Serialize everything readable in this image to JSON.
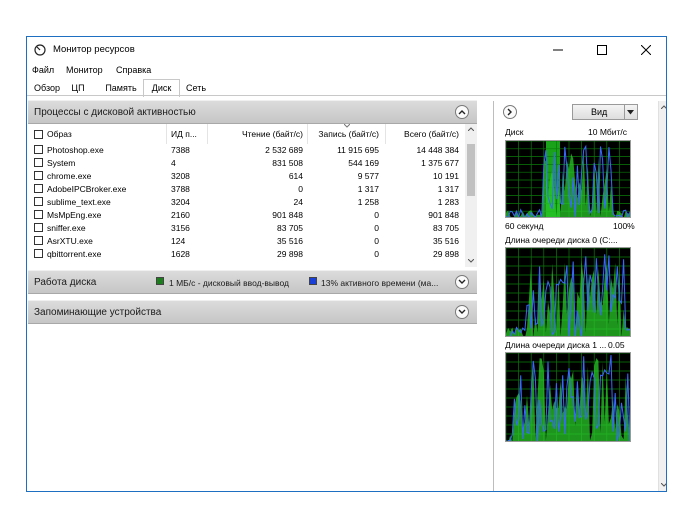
{
  "window": {
    "title": "Монитор ресурсов",
    "minimize_icon": "minimize-icon",
    "maximize_icon": "maximize-icon",
    "close_icon": "close-icon"
  },
  "menu": [
    "Файл",
    "Монитор",
    "Справка"
  ],
  "tabs": [
    {
      "label": "Обзор",
      "active": false
    },
    {
      "label": "ЦП",
      "active": false
    },
    {
      "label": "Память",
      "active": false
    },
    {
      "label": "Диск",
      "active": true
    },
    {
      "label": "Сеть",
      "active": false
    }
  ],
  "processes": {
    "title": "Процессы с дисковой активностью",
    "columns": [
      "Образ",
      "ИД п...",
      "Чтение (байт/с)",
      "Запись (байт/с)",
      "Всего (байт/с)"
    ],
    "rows": [
      {
        "image": "Photoshop.exe",
        "pid": "7388",
        "read": "2 532 689",
        "write": "11 915 695",
        "total": "14 448 384"
      },
      {
        "image": "System",
        "pid": "4",
        "read": "831 508",
        "write": "544 169",
        "total": "1 375 677"
      },
      {
        "image": "chrome.exe",
        "pid": "3208",
        "read": "614",
        "write": "9 577",
        "total": "10 191"
      },
      {
        "image": "AdobeIPCBroker.exe",
        "pid": "3788",
        "read": "0",
        "write": "1 317",
        "total": "1 317"
      },
      {
        "image": "sublime_text.exe",
        "pid": "3204",
        "read": "24",
        "write": "1 258",
        "total": "1 283"
      },
      {
        "image": "MsMpEng.exe",
        "pid": "2160",
        "read": "901 848",
        "write": "0",
        "total": "901 848"
      },
      {
        "image": "sniffer.exe",
        "pid": "3156",
        "read": "83 705",
        "write": "0",
        "total": "83 705"
      },
      {
        "image": "AsrXTU.exe",
        "pid": "124",
        "read": "35 516",
        "write": "0",
        "total": "35 516"
      },
      {
        "image": "qbittorrent.exe",
        "pid": "1628",
        "read": "29 898",
        "write": "0",
        "total": "29 898"
      }
    ]
  },
  "disk_activity": {
    "title": "Работа диска",
    "legend_io": "1 МБ/с - дисковый ввод-вывод",
    "legend_io_color": "#1a7f1a",
    "legend_time": "13% активного времени (ма...",
    "legend_time_color": "#1a3fd6"
  },
  "storage": {
    "title": "Запоминающие устройства"
  },
  "right_panel": {
    "view_label": "Вид",
    "graph1_title": "Диск",
    "graph1_value": "10 Мбит/с",
    "graph1_footer": "60 секунд",
    "graph1_footer_value": "100%",
    "graph2_title": "Длина очереди диска 0 (C:...",
    "graph3_title": "Длина очереди диска 1 ...",
    "graph3_value": "0.05"
  }
}
